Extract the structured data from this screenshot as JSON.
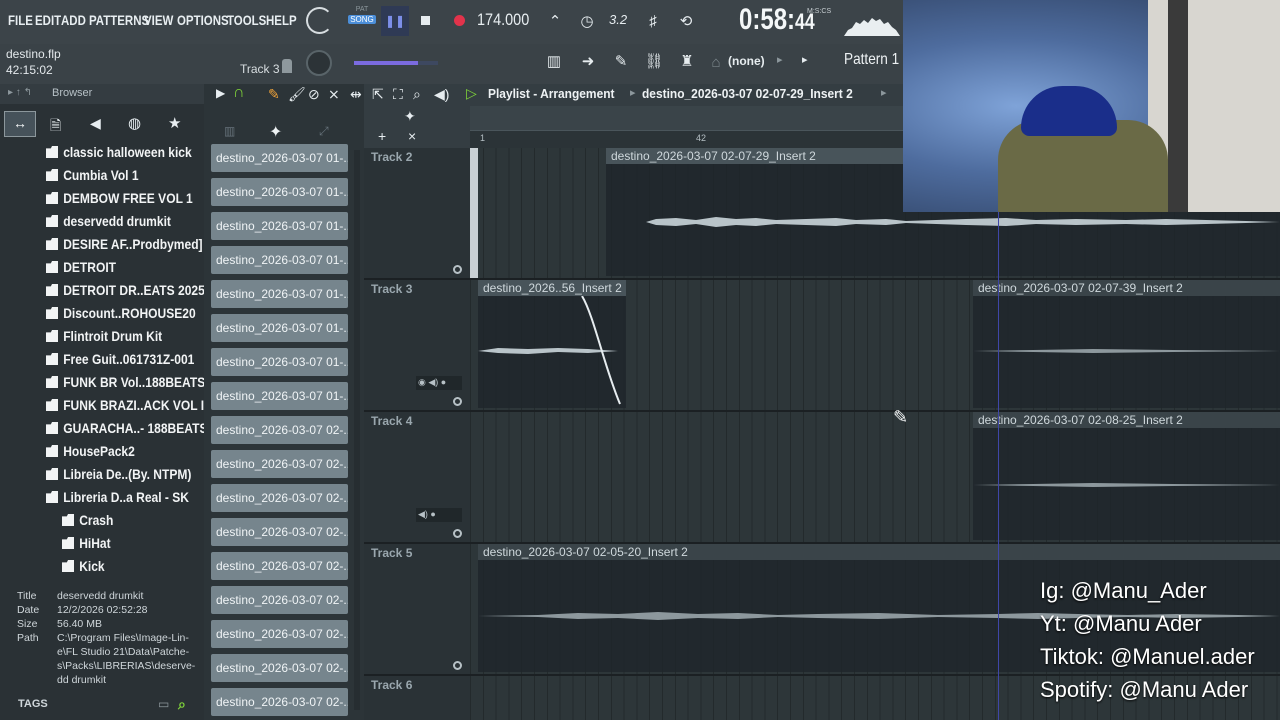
{
  "menu": [
    "FILE",
    "EDIT",
    "ADD",
    "PATTERNS",
    "VIEW",
    "OPTIONS",
    "TOOLS",
    "HELP"
  ],
  "transport": {
    "pat_label": "PAT",
    "song_label": "SONG",
    "tempo": "174.000",
    "tempo_small": "3.2",
    "time_main": "0:58:",
    "time_sub": "44",
    "time_unit": "M:S:CS"
  },
  "project": {
    "filename": "destino.flp",
    "time": "42:15:02",
    "track_label": "Track 3"
  },
  "toolbar2": {
    "pattern_none": "(none)",
    "pattern_name": "Pattern 1"
  },
  "browser": {
    "title": "Browser",
    "items": [
      "classic halloween kick",
      "Cumbia Vol 1",
      "DEMBOW FREE VOL 1",
      "deservedd drumkit",
      "DESIRE AF..Prodbymed]",
      "DETROIT",
      "DETROIT DR..EATS 2025",
      "Discount..ROHOUSE20",
      "Flintroit Drum Kit",
      "Free Guit..061731Z-001",
      "FUNK BR Vol..188BEATS",
      "FUNK BRAZI..ACK VOL II",
      "GUARACHA..- 188BEATS",
      "HousePack2",
      "Libreia De..(By. NTPM)",
      "Libreria D..a Real - SK"
    ],
    "subitems": [
      "Crash",
      "HiHat",
      "Kick"
    ],
    "info": {
      "title_label": "Title",
      "title_value": "deservedd drumkit",
      "date_label": "Date",
      "date_value": "12/2/2026 02:52:28",
      "size_label": "Size",
      "size_value": "56.40 MB",
      "path_label": "Path",
      "path_value_1": "C:\\Program Files\\Image-Lin-",
      "path_value_2": "e\\FL Studio 21\\Data\\Patche-",
      "path_value_3": "s\\Packs\\LIBRERIAS\\deserve-",
      "path_value_4": "dd drumkit"
    },
    "tags_label": "TAGS"
  },
  "picker": [
    "destino_2026-03-07 01-...",
    "destino_2026-03-07 01-...",
    "destino_2026-03-07 01-...",
    "destino_2026-03-07 01-...",
    "destino_2026-03-07 01-...",
    "destino_2026-03-07 01-...",
    "destino_2026-03-07 01-...",
    "destino_2026-03-07 01-...",
    "destino_2026-03-07 02-...",
    "destino_2026-03-07 02-...",
    "destino_2026-03-07 02-...",
    "destino_2026-03-07 02-...",
    "destino_2026-03-07 02-...",
    "destino_2026-03-07 02-...",
    "destino_2026-03-07 02-...",
    "destino_2026-03-07 02-...",
    "destino_2026-03-07 02-..."
  ],
  "playlist": {
    "title": "Playlist - Arrangement",
    "breadcrumb": "destino_2026-03-07 02-07-29_Insert 2",
    "ruler_1": "1",
    "ruler_42": "42",
    "tracks": [
      "Track 2",
      "Track 3",
      "Track 4",
      "Track 5",
      "Track 6"
    ],
    "clips": {
      "t2": "destino_2026-03-07 02-07-29_Insert 2",
      "t3a": "destino_2026..56_Insert 2",
      "t3b": "destino_2026-03-07 02-07-39_Insert 2",
      "t4": "destino_2026-03-07 02-08-25_Insert 2",
      "t5": "destino_2026-03-07 02-05-20_Insert 2"
    }
  },
  "socials": {
    "ig": "Ig: @Manu_Ader",
    "yt": "Yt: @Manu Ader",
    "tiktok": "Tiktok: @Manuel.ader",
    "spotify": "Spotify: @Manu Ader"
  },
  "colors": {
    "accent_green": "#7fd33a",
    "record_red": "#e2334b",
    "clip_gray": "#76858d"
  }
}
